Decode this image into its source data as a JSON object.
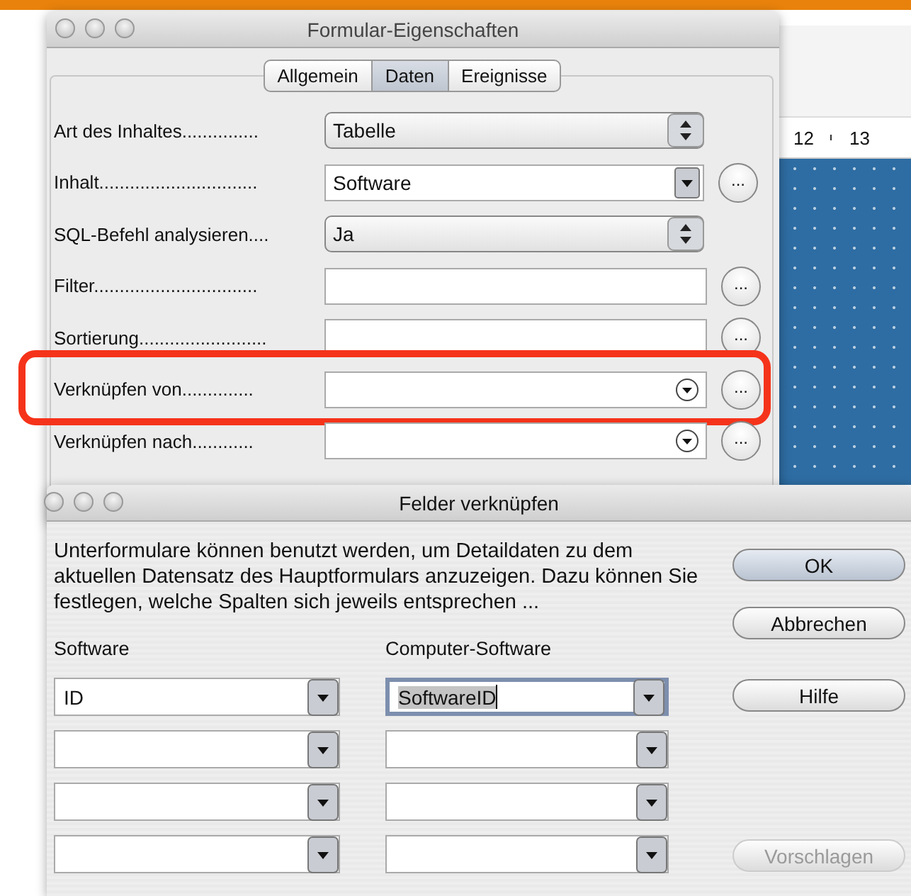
{
  "window": {
    "title": "Formular-Eigenschaften"
  },
  "tabs": [
    {
      "label": "Allgemein",
      "selected": false
    },
    {
      "label": "Daten",
      "selected": true
    },
    {
      "label": "Ereignisse",
      "selected": false
    }
  ],
  "properties": [
    {
      "label": "Art des Inhaltes...............",
      "kind": "listbox",
      "value": "Tabelle",
      "highlighted": false
    },
    {
      "label": "Inhalt...............................",
      "kind": "combo",
      "value": "Software",
      "button": "...",
      "highlighted": false
    },
    {
      "label": "SQL-Befehl analysieren....",
      "kind": "listbox",
      "value": "Ja",
      "highlighted": false
    },
    {
      "label": "Filter................................",
      "kind": "text",
      "button": "...",
      "highlighted": false
    },
    {
      "label": "Sortierung.........................",
      "kind": "text",
      "button": "...",
      "highlighted": false
    },
    {
      "label": "Verknüpfen von..............",
      "kind": "link",
      "button": "...",
      "highlighted": true
    },
    {
      "label": "Verknüpfen nach............",
      "kind": "link",
      "button": "...",
      "highlighted": false
    }
  ],
  "document": {
    "ruler": [
      "12",
      "13"
    ]
  },
  "dialog": {
    "title": "Felder verknüpfen",
    "description": "Unterformulare können benutzt werden, um Detaildaten zu dem aktuellen Datensatz des Hauptformulars anzuzeigen. Dazu können Sie festlegen, welche Spalten sich jeweils entsprechen ...",
    "columns": [
      "Software",
      "Computer-Software"
    ],
    "rows": [
      {
        "fields": [
          {
            "value": "ID",
            "focused": false
          },
          {
            "value": "SoftwareID",
            "focused": true
          }
        ]
      },
      {
        "fields": [
          {
            "focused": false
          },
          {
            "focused": false
          }
        ]
      },
      {
        "fields": [
          {
            "focused": false
          },
          {
            "focused": false
          }
        ]
      },
      {
        "fields": [
          {
            "focused": false
          },
          {
            "focused": false
          }
        ]
      }
    ],
    "buttons": [
      {
        "label": "OK",
        "disabled": false
      },
      {
        "label": "Abbrechen",
        "disabled": false
      },
      {
        "label": "Hilfe",
        "disabled": false
      },
      {
        "label": "Vorschlagen",
        "disabled": true
      }
    ]
  }
}
